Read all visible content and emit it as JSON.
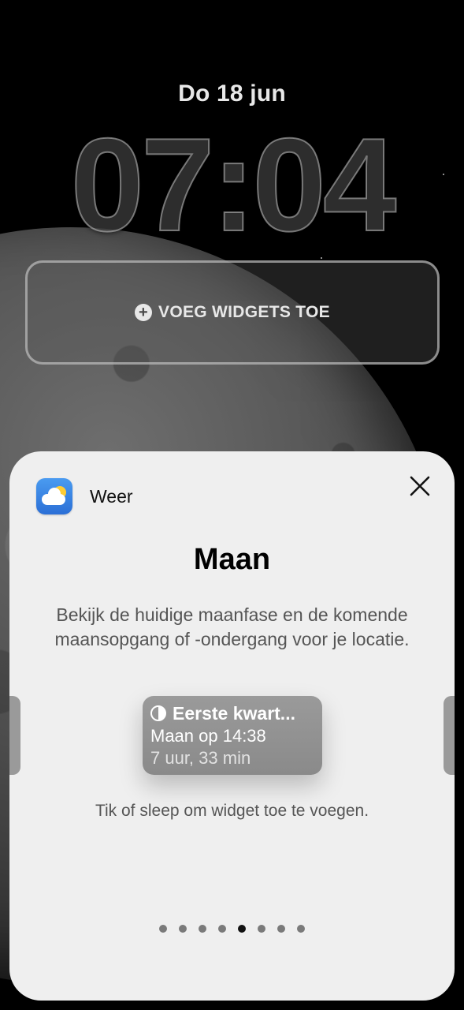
{
  "lockscreen": {
    "date": "Do 18 jun",
    "time": "07:04",
    "add_widgets_label": "VOEG WIDGETS TOE",
    "add_icon": "plus-circle-icon"
  },
  "sheet": {
    "app_name": "Weer",
    "app_icon": "weather-app-icon",
    "close_icon": "close-icon",
    "title": "Maan",
    "description": "Bekijk de huidige maanfase en de komende maansopgang of -ondergang voor je locatie.",
    "preview": {
      "heading": "Eerste kwart...",
      "line2": "Maan op 14:38",
      "line3": "7 uur, 33 min",
      "phase_icon": "half-moon-icon"
    },
    "hint": "Tik of sleep om widget toe te voegen.",
    "pagination": {
      "total": 8,
      "active_index": 4
    }
  },
  "colors": {
    "sheet_background": "#efefef",
    "widget_preview": "#8e8e8e",
    "active_dot": "#111111",
    "inactive_dot": "#7a7a7a"
  }
}
